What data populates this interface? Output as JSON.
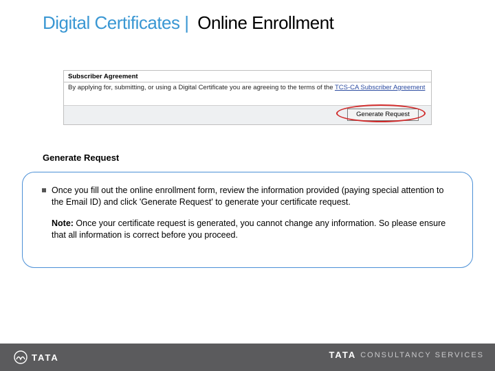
{
  "title": {
    "part1": "Digital Certificates",
    "separator": "|",
    "part2": "Online Enrollment"
  },
  "screenshot": {
    "header": "Subscriber Agreement",
    "body_prefix": "By applying for, submitting, or using a Digital Certificate you are agreeing to the terms of the ",
    "link_text": "TCS-CA Subscriber Agreement",
    "button_label": "Generate Request"
  },
  "section_title": "Generate Request",
  "bullet_text": "Once you fill out the online enrollment form, review the information provided (paying special attention to the Email ID) and click 'Generate Request' to generate your certificate request.",
  "note_label": "Note:",
  "note_text": " Once your certificate request is generated, you cannot change any information. So please ensure that all information is correct before you proceed.",
  "footer": {
    "left_brand": "TATA",
    "right_brand": "TATA",
    "right_sub": "CONSULTANCY SERVICES"
  }
}
